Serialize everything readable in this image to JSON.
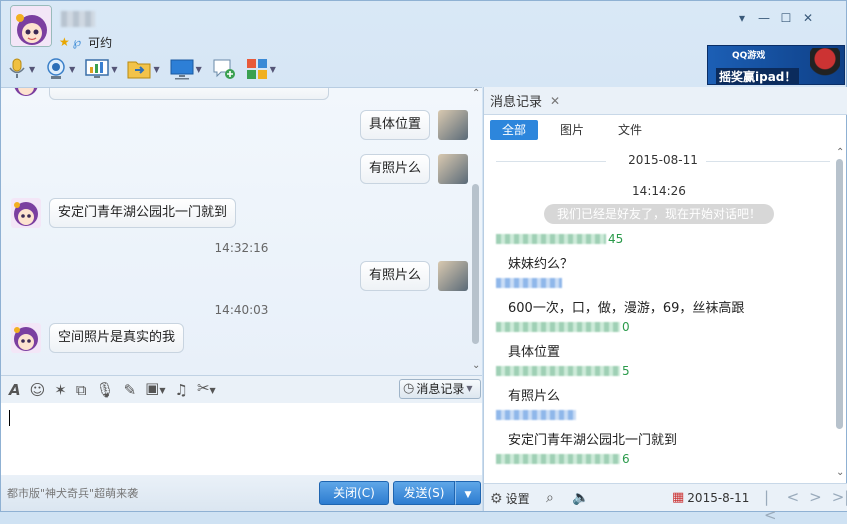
{
  "header": {
    "status": "可约",
    "window_controls": [
      "▾",
      "—",
      "☐",
      "✕"
    ]
  },
  "ad": {
    "logo": "QQ游戏",
    "text": "摇奖赢ipad！"
  },
  "toolbar": {
    "icons": [
      "microphone-icon",
      "webcam-icon",
      "screen-share-icon",
      "file-transfer-icon",
      "remote-desktop-icon",
      "create-discussion-icon",
      "app-grid-icon"
    ]
  },
  "chat": {
    "messages": [
      {
        "text": "具体位置",
        "side": "right"
      },
      {
        "text": "有照片么",
        "side": "right"
      },
      {
        "text": "安定门青年湖公园北一门就到",
        "side": "left"
      },
      {
        "text": "有照片么",
        "side": "right"
      },
      {
        "text": "空间照片是真实的我",
        "side": "left"
      }
    ],
    "timestamps": [
      "14:32:16",
      "14:40:03"
    ]
  },
  "editor": {
    "tools": [
      "font-icon",
      "emoji-icon",
      "shake-icon",
      "screenshot-icon",
      "voice-icon",
      "doodle-icon",
      "image-icon",
      "music-icon",
      "scissors-icon"
    ],
    "history_label": "消息记录"
  },
  "footer": {
    "promo": "都市版\"神犬奇兵\"超萌来袭",
    "close_label": "关闭(C)",
    "send_label": "发送(S)"
  },
  "history": {
    "tab_title": "消息记录",
    "filters": [
      "全部",
      "图片",
      "文件"
    ],
    "date": "2015-08-11",
    "first_time": "14:14:26",
    "system_msg": "我们已经是好友了，现在开始对话吧！",
    "entries": [
      {
        "id_tail": "45",
        "text": "妹妹约么？"
      },
      {
        "id_tail": "",
        "text": "600一次，口，做，漫游，69，丝袜高跟"
      },
      {
        "id_tail": "0",
        "text": "具体位置"
      },
      {
        "id_tail": "5",
        "text": "有照片么"
      },
      {
        "id_tail": "",
        "text": "安定门青年湖公园北一门就到"
      },
      {
        "id_tail": "6",
        "text": ""
      }
    ],
    "settings_label": "设置",
    "bottom_date": "2015-8-11"
  }
}
